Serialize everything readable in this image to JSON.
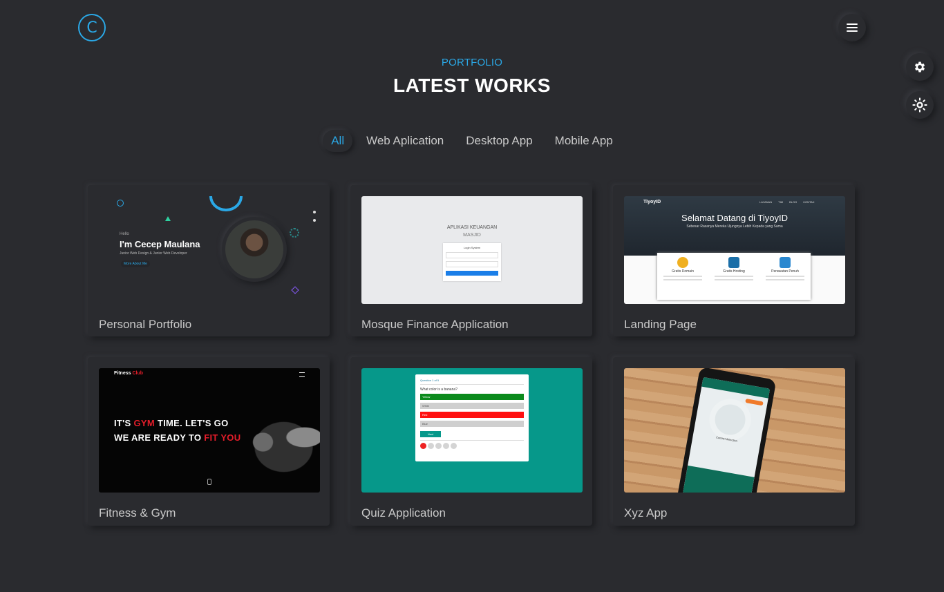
{
  "header": {
    "logo_letter": "C",
    "menu_icon": "hamburger-icon"
  },
  "side_buttons": {
    "settings_icon": "gear-icon",
    "theme_icon": "sun-icon"
  },
  "section": {
    "label": "PORTFOLIO",
    "title": "LATEST WORKS"
  },
  "filters": [
    "All",
    "Web Aplication",
    "Desktop App",
    "Mobile App"
  ],
  "active_filter": "All",
  "works": [
    {
      "caption": "Personal Portfolio",
      "thumb": {
        "hello": "Hello",
        "name": "I'm Cecep Maulana",
        "subtitle": "Junior Web Design & Junior Web Developer",
        "button": "More About Me"
      }
    },
    {
      "caption": "Mosque Finance Application",
      "thumb": {
        "title1": "APLIKASI KEUANGAN",
        "title2": "MASJID",
        "login_title": "Login System"
      }
    },
    {
      "caption": "Landing Page",
      "thumb": {
        "brand": "TiyoyID",
        "nav": "LAYANAN TIM BLOG KONTAK",
        "hero": "Selamat Datang di TiyoyID",
        "hero_sub": "Sebesar Rasanya Mereka Ujungnya Lebih Kepada yang Sama",
        "features": [
          "Gratis Domain",
          "Gratis Hosting",
          "Perawatan Penuh"
        ]
      }
    },
    {
      "caption": "Fitness & Gym",
      "thumb": {
        "brand_a": "Fitness ",
        "brand_b": "Club",
        "line1_a": "IT'S ",
        "line1_b": "GYM",
        "line1_c": " TIME. LET'S GO",
        "line2_a": "WE ARE READY TO ",
        "line2_b": "FIT YOU"
      }
    },
    {
      "caption": "Quiz Application",
      "thumb": {
        "header": "Question 1 of 5",
        "question": "What color is a banana?",
        "options": [
          "Yellow",
          "White",
          "Red",
          "Blue"
        ],
        "next": "Next"
      }
    },
    {
      "caption": "Xyz App",
      "thumb": {
        "text": "Contact detection"
      }
    }
  ],
  "colors": {
    "background": "#2a2b2f",
    "accent": "#2aa8e6",
    "title": "#ffffff",
    "muted": "#c9c9c9"
  }
}
